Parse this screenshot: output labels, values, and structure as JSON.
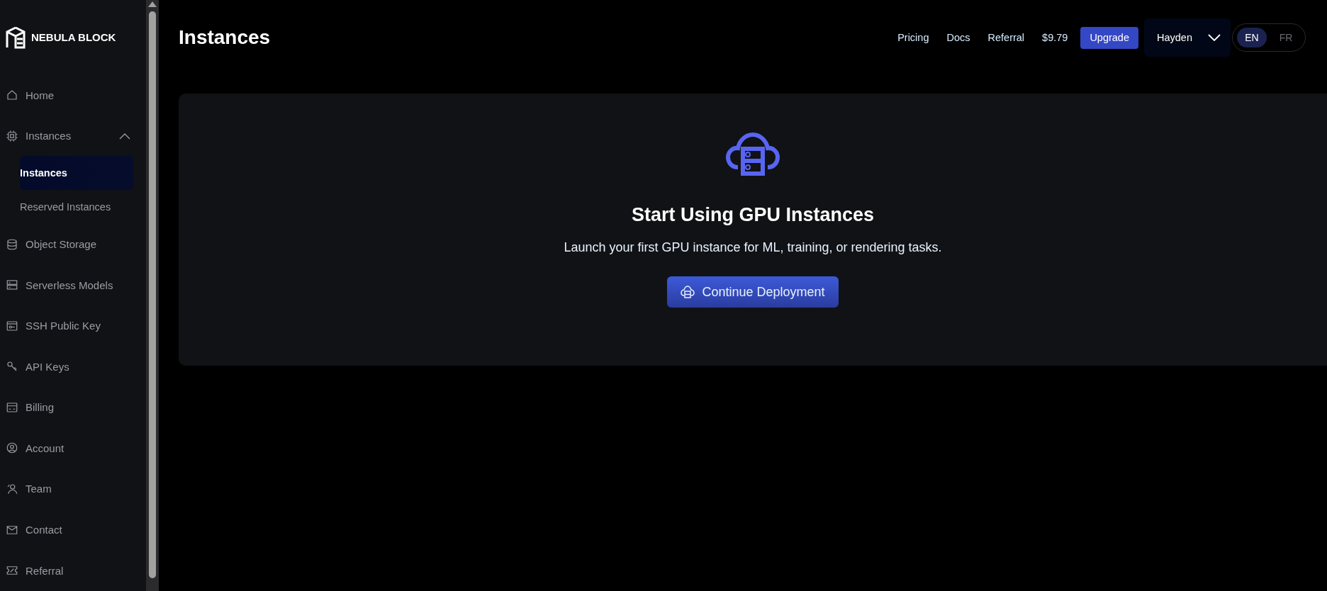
{
  "brand": "NEBULA BLOCK",
  "sidebar": {
    "items": [
      {
        "label": "Home",
        "selected": false
      },
      {
        "label": "Instances",
        "selected": false,
        "expanded": true,
        "children": [
          {
            "label": "Instances",
            "selected": true
          },
          {
            "label": "Reserved Instances",
            "selected": false
          }
        ]
      },
      {
        "label": "Object Storage",
        "selected": false
      },
      {
        "label": "Serverless Models",
        "selected": false
      },
      {
        "label": "SSH Public Key",
        "selected": false
      },
      {
        "label": "API Keys",
        "selected": false
      },
      {
        "label": "Billing",
        "selected": false
      },
      {
        "label": "Account",
        "selected": false
      },
      {
        "label": "Team",
        "selected": false
      },
      {
        "label": "Contact",
        "selected": false
      },
      {
        "label": "Referral",
        "selected": false
      }
    ]
  },
  "header": {
    "title": "Instances",
    "links": [
      "Pricing",
      "Docs",
      "Referral"
    ],
    "balance": "$9.79",
    "upgrade": "Upgrade",
    "user": "Hayden",
    "languages": [
      {
        "label": "EN",
        "selected": true
      },
      {
        "label": "FR",
        "selected": false
      }
    ]
  },
  "empty_state": {
    "title": "Start Using GPU Instances",
    "text": "Launch your first GPU instance for ML, training, or rendering tasks.",
    "button": "Continue Deployment"
  }
}
